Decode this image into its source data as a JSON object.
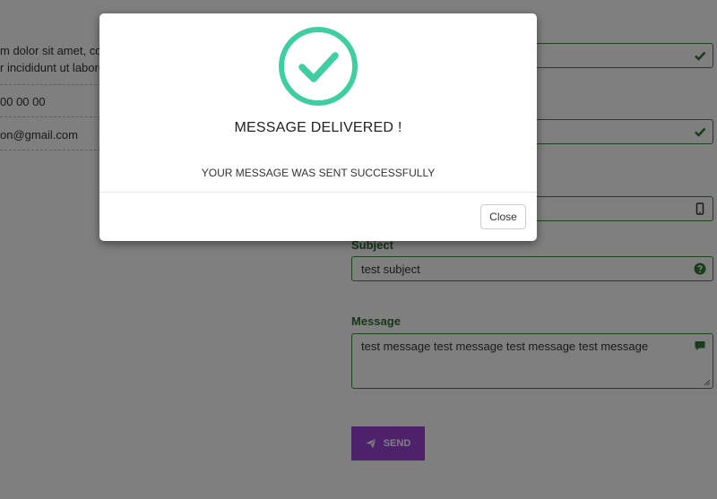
{
  "contact_info": {
    "description_line1": "m dolor sit amet, cons",
    "description_line2": "r incididunt ut labore",
    "phone": "00 00 00",
    "email": "on@gmail.com"
  },
  "form": {
    "name_value": "",
    "email_value": "",
    "phone_value": "",
    "subject_label": "Subject",
    "subject_value": "test subject",
    "message_label": "Message",
    "message_value": "test message test message test message test message",
    "send_label": "SEND",
    "accent_color": "#9b45d6",
    "field_border_color": "#3d8a3d"
  },
  "modal": {
    "icon": "check-circle-icon",
    "icon_color": "#3ecfa0",
    "title": "MESSAGE DELIVERED !",
    "body": "YOUR MESSAGE WAS SENT SUCCESSFULLY",
    "close_label": "Close"
  }
}
